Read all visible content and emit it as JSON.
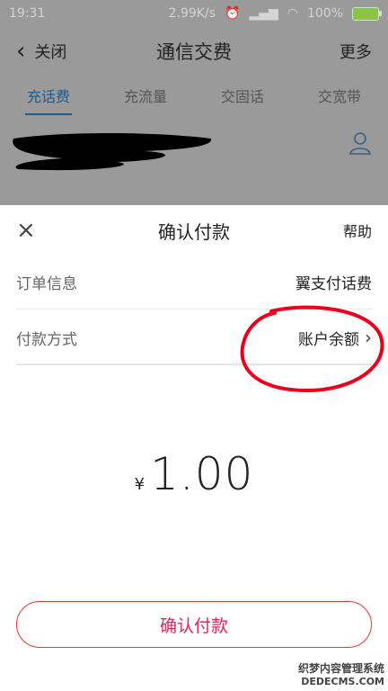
{
  "status_bar": {
    "time": "19:31",
    "speed": "2.99K/s",
    "battery": "100%"
  },
  "top_nav": {
    "back_label": "关闭",
    "title": "通信交费",
    "more_label": "更多"
  },
  "tabs": [
    {
      "label": "充话费",
      "active": true
    },
    {
      "label": "充流量",
      "active": false
    },
    {
      "label": "交固话",
      "active": false
    },
    {
      "label": "交宽带",
      "active": false
    }
  ],
  "sheet": {
    "title": "确认付款",
    "help_label": "帮助",
    "order_info": {
      "label": "订单信息",
      "value": "翼支付话费"
    },
    "payment_method": {
      "label": "付款方式",
      "value": "账户余额"
    },
    "currency": "¥",
    "amount": "1.00",
    "confirm_label": "确认付款"
  },
  "watermark": {
    "line1": "织梦内容管理系统",
    "line2": "DEDECMS.COM"
  },
  "colors": {
    "accent": "#e0245e",
    "tab_active": "#1f5a8f",
    "annotation": "#e8001c"
  }
}
